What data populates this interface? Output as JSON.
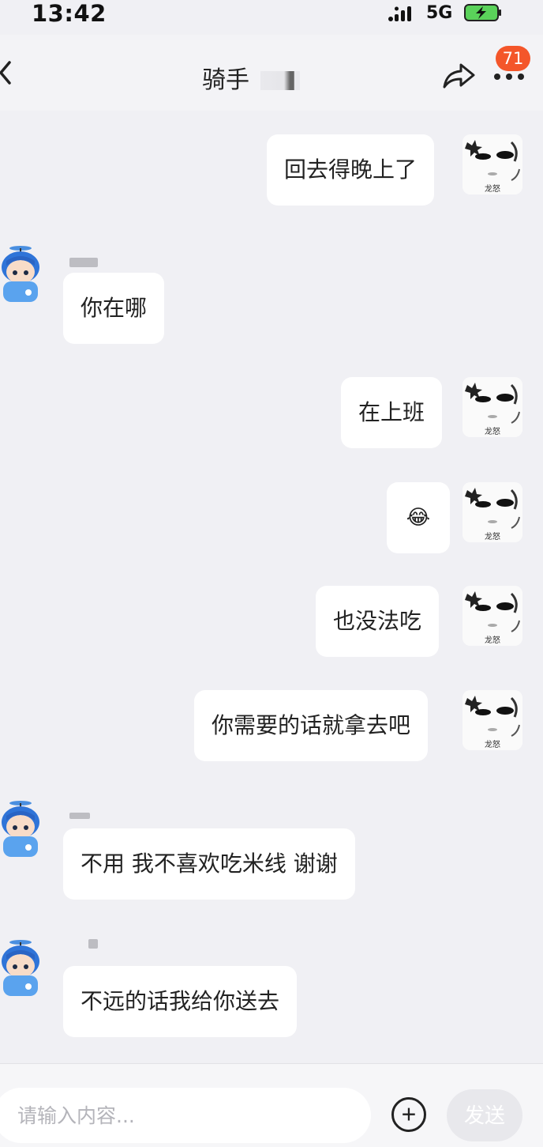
{
  "status_bar": {
    "time": "13:42",
    "network": "5G"
  },
  "header": {
    "title": "骑手",
    "badge_count": "71"
  },
  "messages": [
    {
      "side": "right",
      "text": "回去得晚上了"
    },
    {
      "side": "left",
      "text": "你在哪"
    },
    {
      "side": "right",
      "text": "在上班"
    },
    {
      "side": "right",
      "text": "😂"
    },
    {
      "side": "right",
      "text": "也没法吃"
    },
    {
      "side": "right",
      "text": "你需要的话就拿去吧"
    },
    {
      "side": "left",
      "text": "不用 我不喜欢吃米线 谢谢"
    },
    {
      "side": "left",
      "text": "不远的话我给你送去"
    }
  ],
  "my_avatar_caption": "龙怒",
  "input": {
    "placeholder": "请输入内容...",
    "send_label": "发送"
  },
  "colors": {
    "badge": "#f4562a",
    "background": "#f0f0f4",
    "bubble": "#ffffff",
    "rider_avatar": "#3b8de3"
  }
}
